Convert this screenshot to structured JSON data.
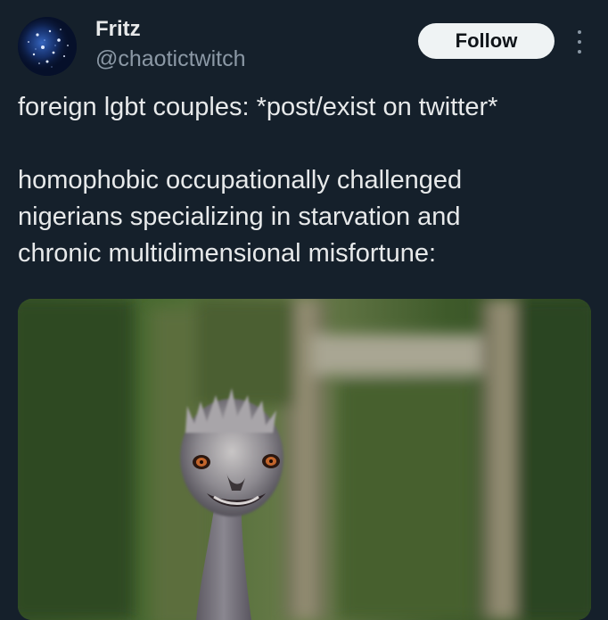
{
  "tweet": {
    "author": {
      "display_name": "Fritz",
      "handle": "@chaotictwitch",
      "avatar_icon": "starry-night-avatar"
    },
    "follow_label": "Follow",
    "more_icon": "vertical-ellipsis-icon",
    "text_lines": [
      "foreign lgbt couples: *post/exist on twitter*",
      "",
      "homophobic occupationally challenged",
      "nigerians specializing in starvation and",
      "chronic multidimensional misfortune:"
    ],
    "media": {
      "kind": "photo",
      "subject": "emu-grinning-photo"
    }
  },
  "colors": {
    "background": "#15202b",
    "text_primary": "#e7e9ea",
    "text_secondary": "#8b98a5",
    "follow_bg": "#eff3f4",
    "follow_text": "#0f1419"
  }
}
